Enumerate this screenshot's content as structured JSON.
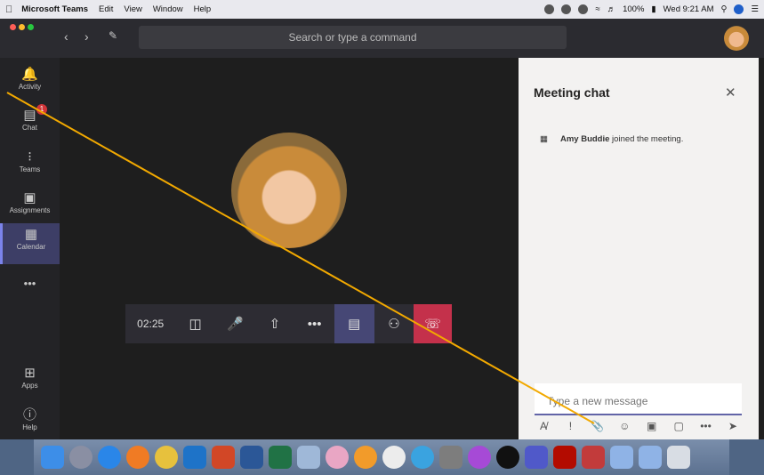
{
  "menubar": {
    "app_name": "Microsoft Teams",
    "menus": [
      "Edit",
      "View",
      "Window",
      "Help"
    ],
    "battery": "100%",
    "clock": "Wed 9:21 AM"
  },
  "titlebar": {
    "search_placeholder": "Search or type a command"
  },
  "rail": {
    "items": [
      {
        "label": "Activity",
        "icon": "bell-icon"
      },
      {
        "label": "Chat",
        "icon": "chat-icon",
        "badge": "1"
      },
      {
        "label": "Teams",
        "icon": "teams-icon"
      },
      {
        "label": "Assignments",
        "icon": "assignments-icon"
      },
      {
        "label": "Calendar",
        "icon": "calendar-icon"
      },
      {
        "label": "Apps",
        "icon": "apps-icon"
      },
      {
        "label": "Help",
        "icon": "help-icon"
      }
    ],
    "more": "•••"
  },
  "callbar": {
    "timer": "02:25"
  },
  "chat": {
    "title": "Meeting chat",
    "event_name": "Amy Buddie",
    "event_text": " joined the meeting.",
    "composer_placeholder": "Type a new message"
  },
  "colors": {
    "accent": "#6264a7",
    "hangup": "#c4314b",
    "annotation": "#f2a900"
  }
}
